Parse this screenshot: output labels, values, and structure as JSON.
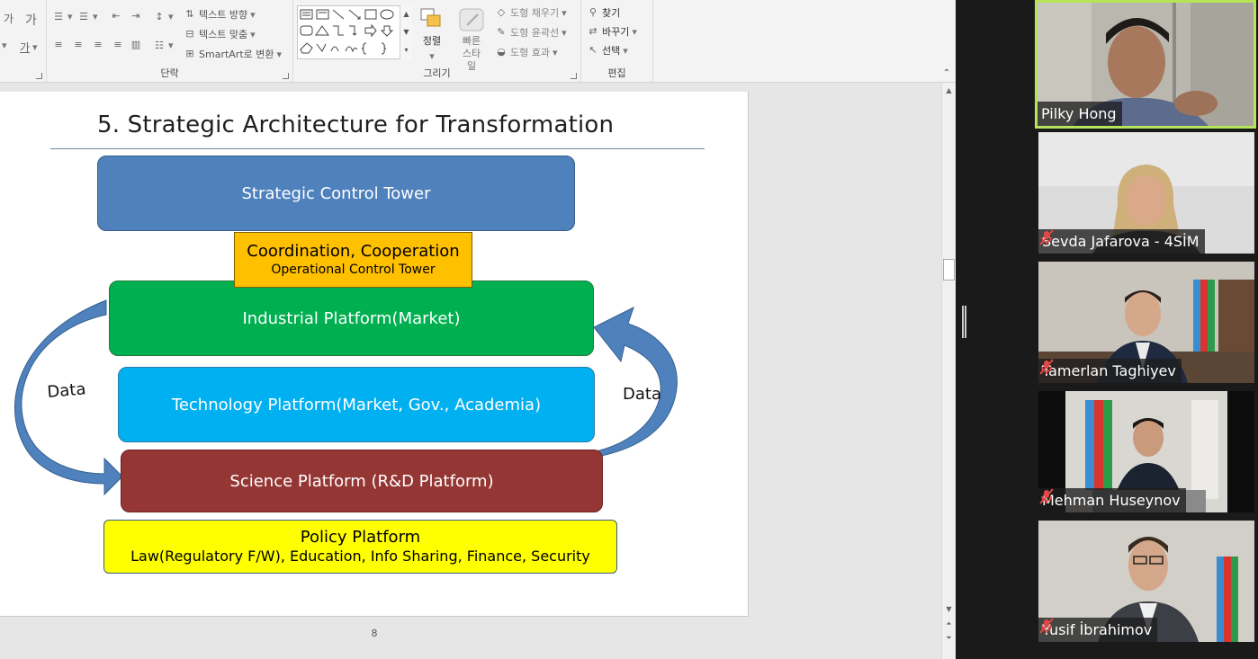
{
  "ribbon": {
    "groups": {
      "paragraph_label": "단락",
      "drawing_label": "그리기",
      "editing_label": "편집"
    },
    "tools": {
      "text_direction": "텍스트 방향",
      "align_text": "텍스트 맞춤",
      "smartart": "SmartArt로 변환",
      "arrange": "정렬",
      "quick_styles": "빠른 스타일",
      "shape_fill": "도형 채우기",
      "shape_outline": "도형 윤곽선",
      "shape_effects": "도형 효과",
      "find": "찾기",
      "replace": "바꾸기",
      "select": "선택",
      "font_glyph_1": "가",
      "font_glyph_2": "가"
    }
  },
  "slide": {
    "title": "5. Strategic Architecture for Transformation",
    "page_number": "8",
    "boxes": {
      "control_tower": "Strategic Control Tower",
      "coordination_line1": "Coordination, Cooperation",
      "coordination_line2": "Operational Control Tower",
      "industrial": "Industrial Platform(Market)",
      "technology": "Technology Platform(Market, Gov., Academia)",
      "science": "Science Platform (R&D Platform)",
      "policy_line1": "Policy Platform",
      "policy_line2": "Law(Regulatory F/W), Education, Info Sharing, Finance, Security"
    },
    "arrows": {
      "left_label": "Data",
      "right_label": "Data"
    },
    "colors": {
      "control_tower": "#4f81bd",
      "coordination": "#ffc000",
      "industrial": "#00b050",
      "technology": "#00b0f0",
      "science": "#943634",
      "policy": "#ffff00",
      "arrow": "#4f81bd"
    }
  },
  "participants": [
    {
      "name": "Pilky Hong",
      "muted": false,
      "active": true
    },
    {
      "name": "Sevda Jafarova - 4SİM",
      "muted": true,
      "active": false
    },
    {
      "name": "Tamerlan Taghiyev",
      "muted": true,
      "active": false
    },
    {
      "name": "Mehman Huseynov",
      "muted": true,
      "active": false
    },
    {
      "name": "Yusif İbrahimov",
      "muted": true,
      "active": false
    }
  ]
}
